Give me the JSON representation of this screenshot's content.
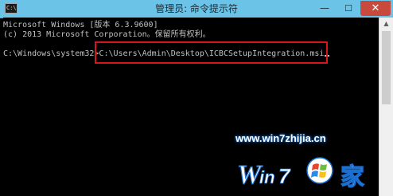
{
  "window": {
    "title": "管理员: 命令提示符",
    "icon_text": "C:\\",
    "buttons": {
      "minimize": "—",
      "maximize": "☐",
      "close": "✕"
    }
  },
  "console": {
    "lines": [
      "Microsoft Windows [版本 6.3.9600]",
      "(c) 2013 Microsoft Corporation。保留所有权利。"
    ],
    "prompt": "C:\\Windows\\system32>",
    "command": "C:\\Users\\Admin\\Desktop\\ICBCSetupIntegration.msi"
  },
  "scrollbar": {
    "up_arrow": "▲"
  },
  "watermark": {
    "url": "www.win7zhijia.cn",
    "logo_text": "W",
    "logo_suffix": "家"
  },
  "colors": {
    "titlebar": "#6bc4e8",
    "console_bg": "#000000",
    "console_text": "#c0c0c0",
    "highlight": "#d8141c",
    "close_button": "#c74a3c"
  }
}
